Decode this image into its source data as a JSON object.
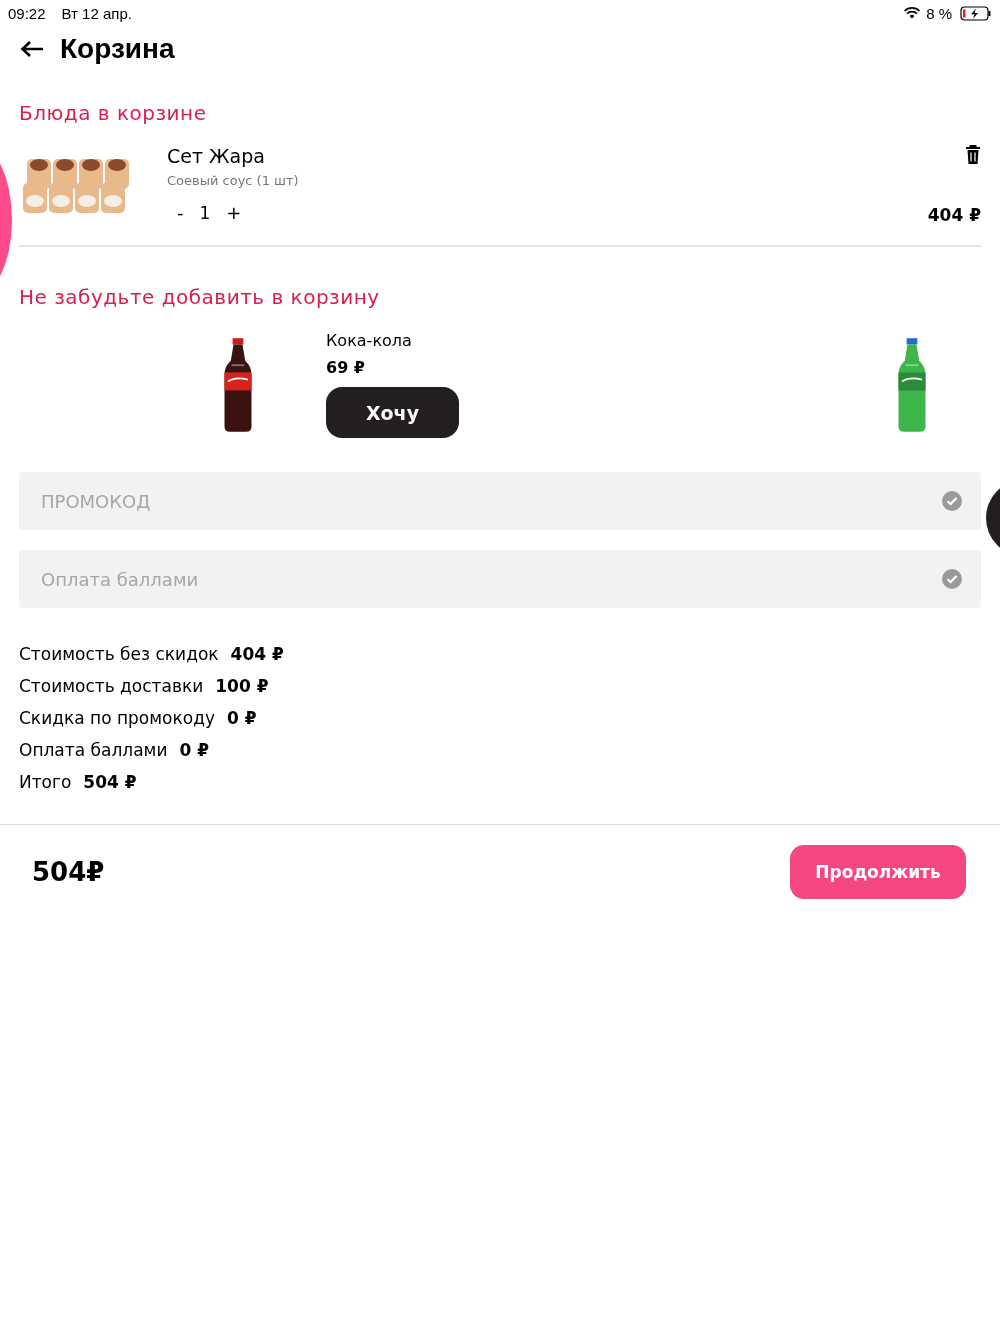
{
  "status_bar": {
    "time": "09:22",
    "date": "Вт 12 апр.",
    "battery": "8 %"
  },
  "header": {
    "title": "Корзина"
  },
  "cart": {
    "title": "Блюда в корзине",
    "items": [
      {
        "kind": "picture",
        "name": "Сет Жара",
        "option": "Соевый соус (1 шт)",
        "minus": "-",
        "quantity": "1",
        "plus": "+",
        "price": "404 ₽"
      }
    ]
  },
  "suggestions": {
    "title": "Не забудьте добавить в корзину",
    "items": [
      {
        "kind": "picture",
        "name": "Кока-кола",
        "price": "69 ₽",
        "button": "Хочу"
      },
      {
        "kind": "picture"
      }
    ]
  },
  "fields": [
    {
      "placeholder": "ПРОМОКОД"
    },
    {
      "placeholder": "Оплата баллами"
    }
  ],
  "summary": [
    {
      "label": "Стоимость без скидок",
      "value": "404 ₽"
    },
    {
      "label": "Стоимость доставки",
      "value": "100 ₽"
    },
    {
      "label": "Скидка по промокоду",
      "value": "0 ₽"
    },
    {
      "label": "Оплата баллами",
      "value": "0 ₽"
    },
    {
      "label": "Итого",
      "value": "504 ₽"
    }
  ],
  "footer": {
    "total": "504₽",
    "button": "Продолжить"
  }
}
